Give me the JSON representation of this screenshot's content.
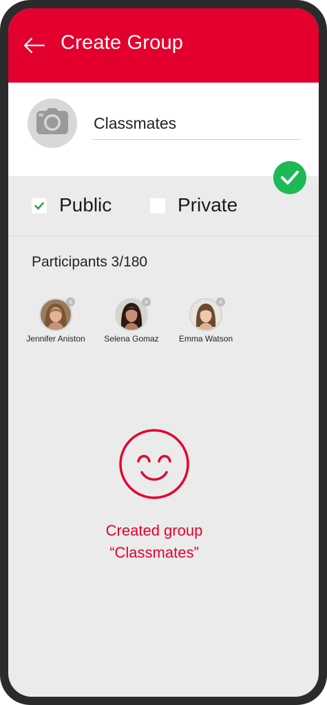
{
  "header": {
    "title": "Create Group",
    "back_icon": "arrow-left-icon",
    "background_color": "#e3002f"
  },
  "group": {
    "name_value": "Classmates",
    "avatar_icon": "camera-icon",
    "confirm_icon": "check-icon",
    "confirm_color": "#1db954"
  },
  "privacy": {
    "public_label": "Public",
    "public_checked": true,
    "private_label": "Private",
    "private_checked": false
  },
  "participants": {
    "title": "Participants 3/180",
    "list": [
      {
        "name": "Jennifer Aniston",
        "remove_label": "x"
      },
      {
        "name": "Selena Gomaz",
        "remove_label": "x"
      },
      {
        "name": "Emma Watson",
        "remove_label": "x"
      }
    ]
  },
  "result": {
    "icon": "smiley-face-icon",
    "line1": "Created group",
    "line2": "“Classmates”",
    "color": "#e3002f"
  }
}
